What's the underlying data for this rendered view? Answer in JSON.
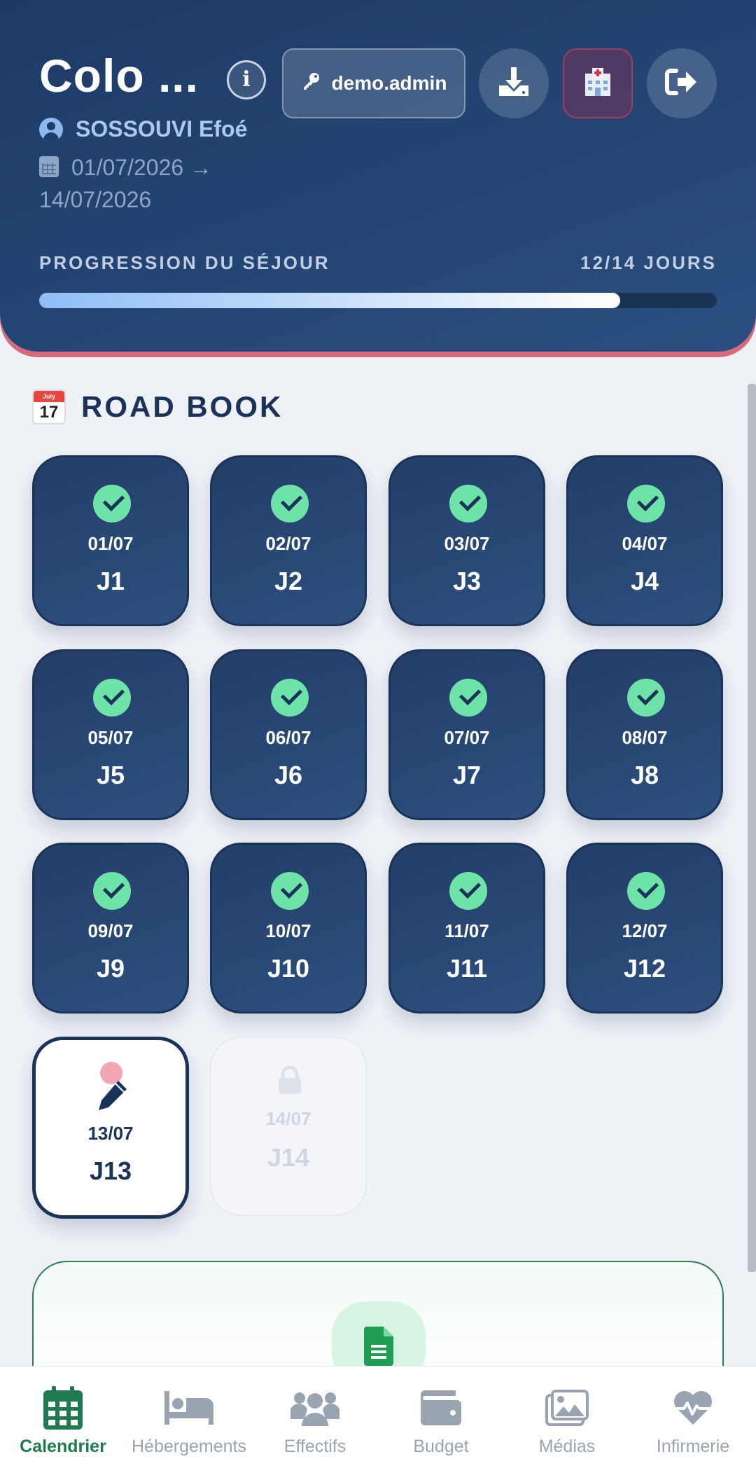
{
  "header": {
    "title": "Colo ...",
    "user_name": "SOSSOUVI Efoé",
    "date_start": "01/07/2026 →",
    "date_end": "14/07/2026",
    "info_label": "i",
    "admin_label": "demo.admin",
    "progress_label": "PROGRESSION DU SÉJOUR",
    "progress_days": "12/14 JOURS",
    "progress_fraction": 0.857
  },
  "road_book": {
    "title": "ROAD BOOK",
    "calendar_emoji_month": "July",
    "calendar_emoji_day": "17",
    "days": [
      {
        "date": "01/07",
        "label": "J1",
        "state": "done"
      },
      {
        "date": "02/07",
        "label": "J2",
        "state": "done"
      },
      {
        "date": "03/07",
        "label": "J3",
        "state": "done"
      },
      {
        "date": "04/07",
        "label": "J4",
        "state": "done"
      },
      {
        "date": "05/07",
        "label": "J5",
        "state": "done"
      },
      {
        "date": "06/07",
        "label": "J6",
        "state": "done"
      },
      {
        "date": "07/07",
        "label": "J7",
        "state": "done"
      },
      {
        "date": "08/07",
        "label": "J8",
        "state": "done"
      },
      {
        "date": "09/07",
        "label": "J9",
        "state": "done"
      },
      {
        "date": "10/07",
        "label": "J10",
        "state": "done"
      },
      {
        "date": "11/07",
        "label": "J11",
        "state": "done"
      },
      {
        "date": "12/07",
        "label": "J12",
        "state": "done"
      },
      {
        "date": "13/07",
        "label": "J13",
        "state": "current"
      },
      {
        "date": "14/07",
        "label": "J14",
        "state": "locked"
      }
    ]
  },
  "bottom_nav": [
    {
      "label": "Calendrier",
      "icon": "calendar-icon",
      "active": true
    },
    {
      "label": "Hébergements",
      "icon": "bed-icon",
      "active": false
    },
    {
      "label": "Effectifs",
      "icon": "users-icon",
      "active": false
    },
    {
      "label": "Budget",
      "icon": "wallet-icon",
      "active": false
    },
    {
      "label": "Médias",
      "icon": "images-icon",
      "active": false
    },
    {
      "label": "Infirmerie",
      "icon": "heart-pulse-icon",
      "active": false
    }
  ],
  "colors": {
    "header_bg": "#1d3a66",
    "accent_green": "#6ee3a8",
    "nav_active": "#1f7a4f",
    "header_shadow": "#d86a7d"
  }
}
